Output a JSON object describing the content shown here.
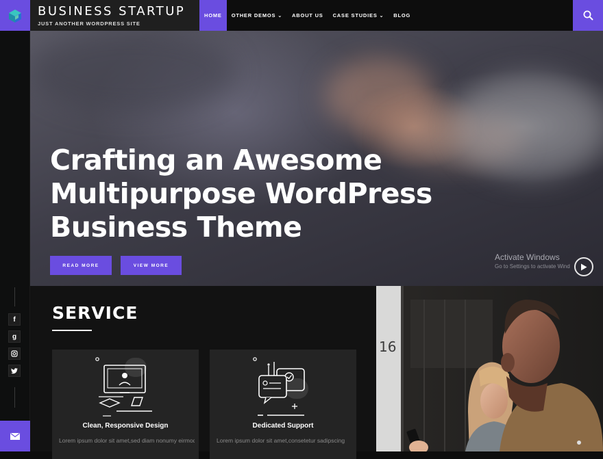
{
  "brand": {
    "title": "BUSINESS STARTUP",
    "tagline": "JUST ANOTHER WORDPRESS SITE"
  },
  "nav": {
    "items": [
      {
        "label": "HOME",
        "active": true,
        "dropdown": false
      },
      {
        "label": "OTHER DEMOS",
        "active": false,
        "dropdown": true
      },
      {
        "label": "ABOUT US",
        "active": false,
        "dropdown": false
      },
      {
        "label": "CASE STUDIES",
        "active": false,
        "dropdown": true
      },
      {
        "label": "BLOG",
        "active": false,
        "dropdown": false
      }
    ]
  },
  "hero": {
    "title_lines": [
      "Crafting an Awesome",
      "Multipurpose WordPress",
      "Business Theme"
    ],
    "buttons": {
      "read_more": "READ MORE",
      "view_more": "VIEW MORE"
    }
  },
  "watermark": {
    "title": "Activate Windows",
    "subtitle": "Go to Settings to activate Wind"
  },
  "social": {
    "icons": [
      {
        "name": "facebook-icon",
        "glyph": "f"
      },
      {
        "name": "google-plus-icon",
        "glyph": "g"
      },
      {
        "name": "instagram-icon",
        "glyph": "◘"
      },
      {
        "name": "twitter-icon",
        "glyph": "t"
      }
    ]
  },
  "service": {
    "heading": "SERVICE",
    "cards": [
      {
        "title": "Clean, Responsive Design",
        "text": "Lorem ipsum dolor sit amet,sed diam nonumy eirmod",
        "icon": "monitor-icon"
      },
      {
        "title": "Dedicated Support",
        "text": "Lorem ipsum dolor sit amet,consetetur sadipscing",
        "icon": "chat-support-icon"
      }
    ]
  },
  "colors": {
    "accent": "#6a4de0",
    "header_bg": "#0d0d0d",
    "brand_bg": "#1f1f1f",
    "card_bg": "#242424"
  }
}
